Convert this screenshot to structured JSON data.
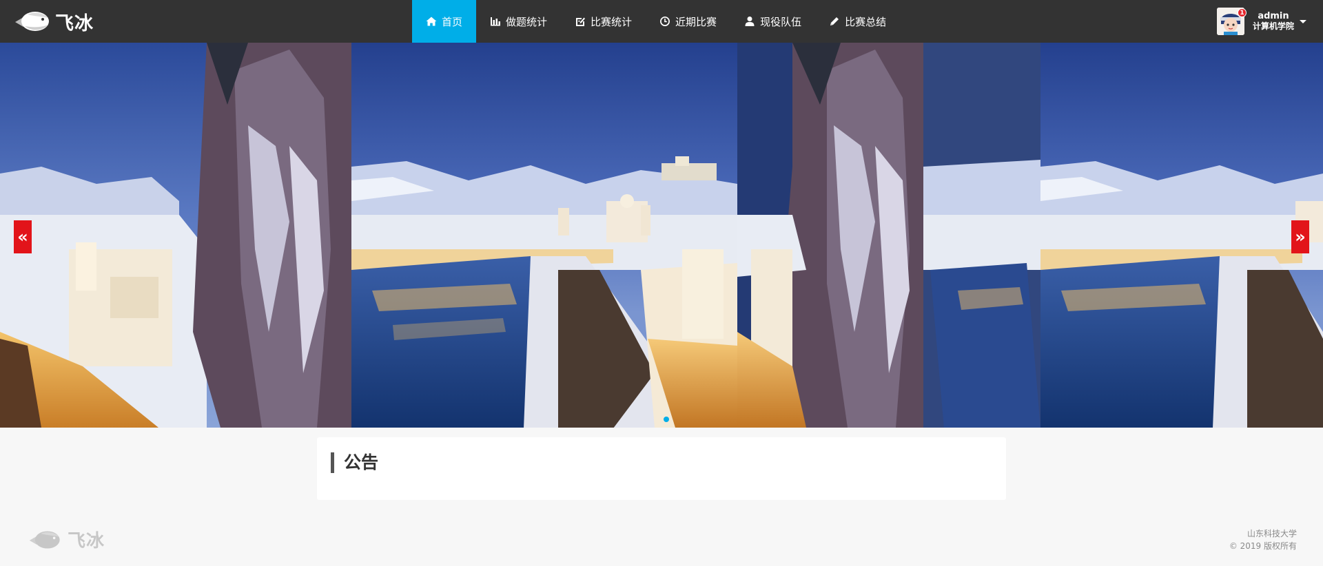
{
  "header": {
    "logo_text": "飞冰",
    "nav": [
      {
        "label": "首页",
        "icon": "home-icon",
        "active": true
      },
      {
        "label": "做题统计",
        "icon": "bar-chart-icon",
        "active": false
      },
      {
        "label": "比赛统计",
        "icon": "note-icon",
        "active": false
      },
      {
        "label": "近期比赛",
        "icon": "clock-icon",
        "active": false
      },
      {
        "label": "现役队伍",
        "icon": "user-icon",
        "active": false
      },
      {
        "label": "比赛总结",
        "icon": "pencil-icon",
        "active": false
      }
    ],
    "user": {
      "name": "admin",
      "org": "计算机学院",
      "badge_count": "1"
    }
  },
  "banner": {
    "prev_label": "«",
    "next_label": "»",
    "slides": 1
  },
  "notice": {
    "title": "公告"
  },
  "footer": {
    "logo_text": "飞冰",
    "line1": "山东科技大学",
    "line2": "© 2019 版权所有"
  },
  "colors": {
    "topbar": "#333333",
    "accent": "#00aee8",
    "arrow": "#e2141a"
  }
}
